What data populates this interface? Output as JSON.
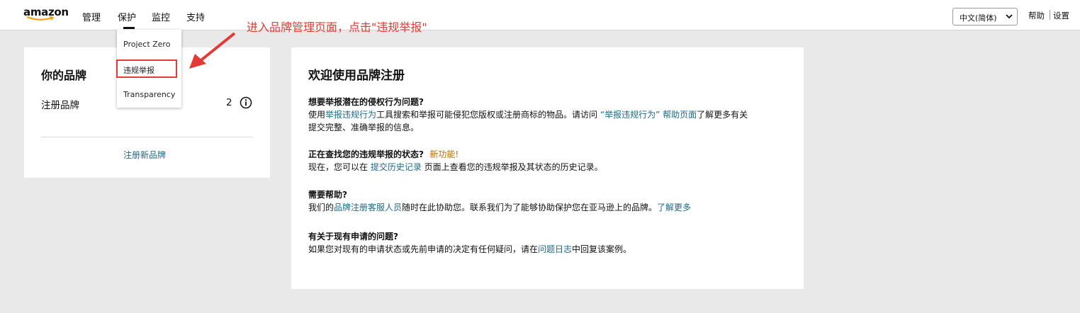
{
  "brand_logo": "amazon",
  "nav": {
    "items": [
      "管理",
      "保护",
      "监控",
      "支持"
    ],
    "active": "保护"
  },
  "lang_select": {
    "value": "中文(简体)"
  },
  "top_links": {
    "help": "帮助",
    "settings": "设置"
  },
  "dropdown": {
    "items": [
      "Project Zero",
      "违规举报",
      "Transparency"
    ],
    "highlighted": "违规举报"
  },
  "annotation": {
    "text": "进入品牌管理页面，点击\"违规举报\"",
    "color": "#e53935"
  },
  "brand_card": {
    "title": "你的品牌",
    "registered_label": "注册品牌",
    "registered_count": "2",
    "register_new": "注册新品牌"
  },
  "main": {
    "title": "欢迎使用品牌注册",
    "sections": [
      {
        "heading": "想要举报潜在的侵权行为问题?",
        "t1": "使用",
        "l1": "举报违规行为",
        "t2": "工具搜索和举报可能侵犯您版权或注册商标的物品。请访问",
        "l2": " “举报违规行为” 帮助页面",
        "t3": "了解更多有关",
        "t4": "提交完整、准确举报的信息。"
      },
      {
        "heading": "正在查找您的违规举报的状态?",
        "badge": "新功能!",
        "t1": "现在，您可以在 ",
        "l1": "提交历史记录",
        "t2": " 页面上查看您的违规举报及其状态的历史记录。"
      },
      {
        "heading": "需要帮助?",
        "t1": "我们的",
        "l1": "品牌注册客服人员",
        "t2": "随时在此协助您。联系我们为了能够协助保护您在亚马逊上的品牌。",
        "l2": "了解更多"
      },
      {
        "heading": "有关于现有申请的问题?",
        "t1": "如果您对现有的申请状态或先前申请的决定有任何疑问，请在",
        "l1": "问题日志",
        "t2": "中回复该案例。"
      }
    ]
  },
  "colors": {
    "link": "#1a6b8a",
    "new_badge": "#c46b00",
    "background": "#e9e9e9"
  }
}
